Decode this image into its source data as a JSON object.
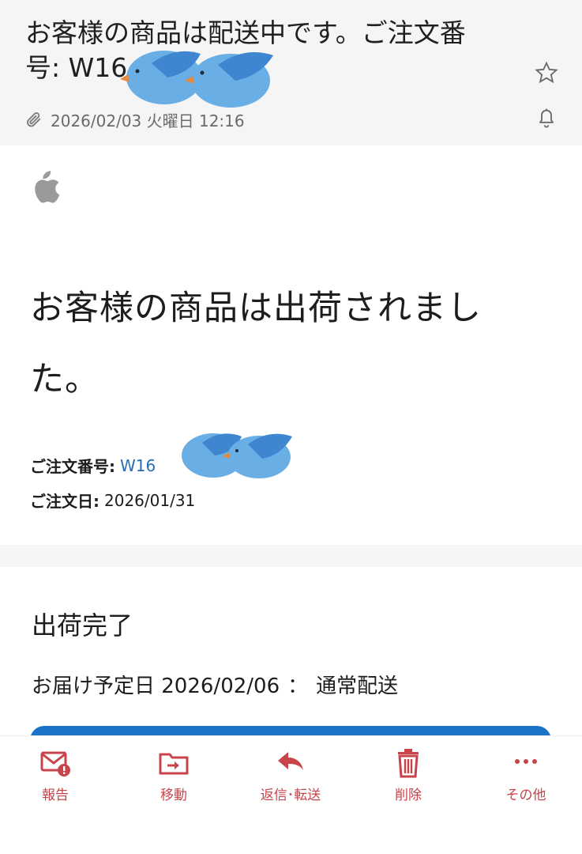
{
  "header": {
    "subject_line1": "お客様の商品は配送中です。ご注文番",
    "subject_line2": "号: W16",
    "datetime": "2026/02/03 火曜日 12:16"
  },
  "content": {
    "headline_line1": "お客様の商品は出荷されまし",
    "headline_line2": "た。",
    "order_number_label": "ご注文番号:",
    "order_number_value": "W16",
    "order_date_label": "ご注文日:",
    "order_date_value": "2026/01/31"
  },
  "shipping": {
    "title": "出荷完了",
    "eta_label": "お届け予定日 2026/02/06",
    "separator": "：",
    "method": "通常配送"
  },
  "toolbar": {
    "report": "報告",
    "move": "移動",
    "reply": "返信･転送",
    "delete": "削除",
    "more": "その他"
  },
  "icons": {
    "star": "star-icon",
    "bell": "bell-icon",
    "attachment": "paperclip-icon",
    "logo": "apple-logo-icon",
    "report": "mail-alert-icon",
    "move": "folder-move-icon",
    "reply": "reply-arrow-icon",
    "delete": "trash-icon",
    "more": "more-dots-icon"
  },
  "colors": {
    "accent": "#c8444a",
    "link": "#2a6bb5",
    "bar": "#1a73c8"
  }
}
